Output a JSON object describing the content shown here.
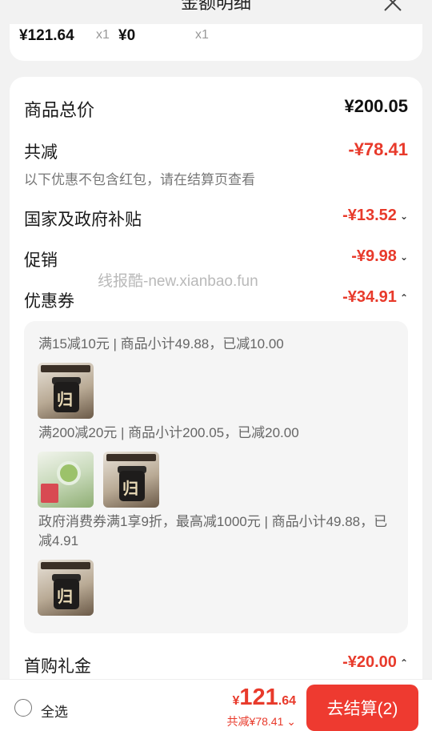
{
  "header": {
    "title": "金额明细"
  },
  "top_item": {
    "price1": "¥121.64",
    "qty1": "x1",
    "price2": "¥0",
    "qty2": "x1"
  },
  "summary": {
    "total_label": "商品总价",
    "total_value": "¥200.05",
    "discount_label": "共减",
    "discount_value": "-¥78.41",
    "note": "以下优惠不包含红包，请在结算页查看"
  },
  "discounts": [
    {
      "label": "国家及政府补贴",
      "value": "-¥13.52",
      "chevron": "chevron-down-icon",
      "glyph": "⌄"
    },
    {
      "label": "促销",
      "value": "-¥9.98",
      "chevron": "chevron-down-icon",
      "glyph": "⌄"
    },
    {
      "label": "优惠券",
      "value": "-¥34.91",
      "chevron": "chevron-up-icon",
      "glyph": "⌃"
    }
  ],
  "coupons": [
    {
      "text": "满15减10元 | 商品小计49.88，已减10.00"
    },
    {
      "text": "满200减20元 | 商品小计200.05，已减20.00"
    },
    {
      "text": "政府消费券满1享9折，最高减1000元 | 商品小计49.88，已减4.91"
    }
  ],
  "first_purchase": {
    "label": "首购礼金",
    "value": "-¥20.00",
    "chevron": "chevron-up-icon",
    "glyph": "⌃"
  },
  "watermark": "线报酷-new.xianbao.fun",
  "bottom": {
    "select_all": "全选",
    "currency": "¥",
    "price_int": "121",
    "price_dec": ".64",
    "discount_total": "共减¥78.41",
    "checkout": "去结算(2)"
  },
  "colors": {
    "accent": "#ee3a30",
    "discount_text": "#e83a2b"
  }
}
